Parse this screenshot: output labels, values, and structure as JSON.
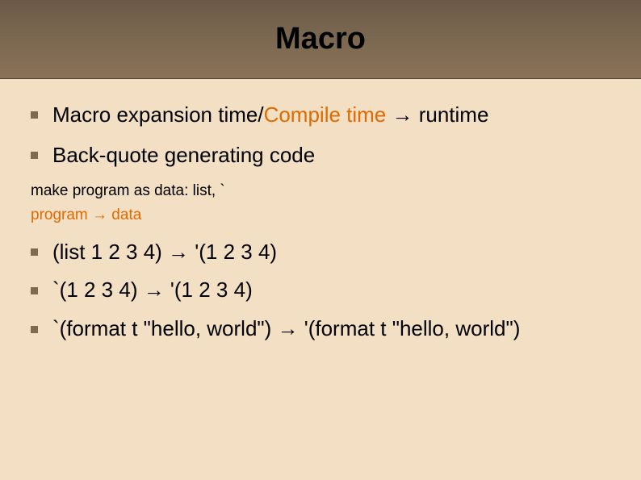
{
  "title": "Macro",
  "bullets_top": [
    {
      "parts": [
        {
          "text": "Macro expansion time/",
          "cls": ""
        },
        {
          "text": "Compile time",
          "cls": "orange"
        },
        {
          "text": " → runtime",
          "cls": ""
        }
      ]
    },
    {
      "parts": [
        {
          "text": "Back-quote generating code",
          "cls": ""
        }
      ]
    }
  ],
  "note1": "make program as data: list, `",
  "note2": "program → data",
  "bullets_bottom": [
    {
      "text": "(list 1 2 3 4) → '(1 2 3 4)"
    },
    {
      "text": "`(1 2 3 4) → '(1 2 3 4)"
    },
    {
      "text": "`(format t \"hello, world\") → '(format t \"hello, world\")"
    }
  ]
}
